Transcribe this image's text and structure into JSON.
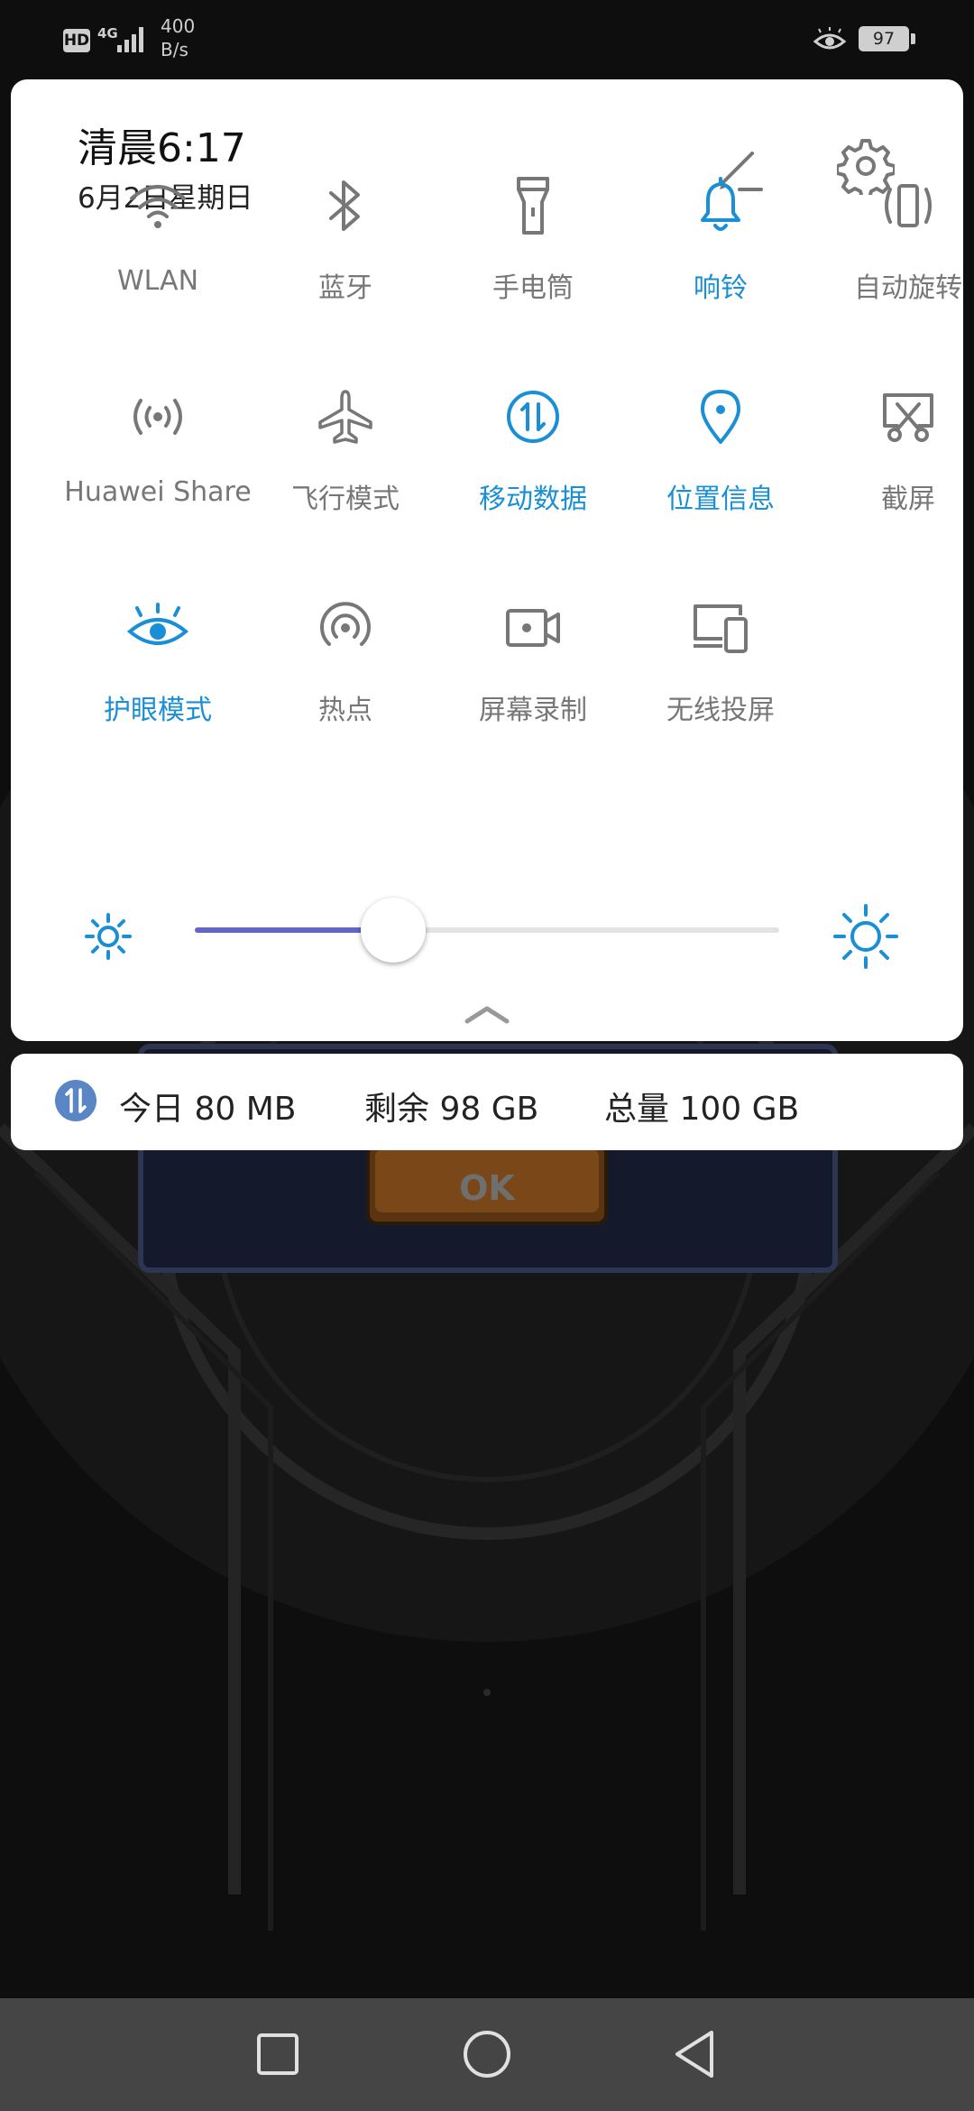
{
  "status_bar": {
    "hd": "HD",
    "network": "4G",
    "speed_value": "400",
    "speed_unit": "B/s",
    "battery": "97"
  },
  "header": {
    "time": "清晨6:17",
    "date": "6月2日星期日"
  },
  "colors": {
    "active": "#1a8fd6",
    "inactive": "#777777",
    "slider_fill": "#6366c8",
    "panel_bg": "#ffffff"
  },
  "tiles": [
    {
      "label": "WLAN",
      "icon": "wifi-icon",
      "active": false
    },
    {
      "label": "蓝牙",
      "icon": "bluetooth-icon",
      "active": false
    },
    {
      "label": "手电筒",
      "icon": "flashlight-icon",
      "active": false
    },
    {
      "label": "响铃",
      "icon": "bell-icon",
      "active": true
    },
    {
      "label": "自动旋转",
      "icon": "rotate-icon",
      "active": false
    },
    {
      "label": "Huawei Share",
      "icon": "huawei-share-icon",
      "active": false
    },
    {
      "label": "飞行模式",
      "icon": "airplane-icon",
      "active": false
    },
    {
      "label": "移动数据",
      "icon": "mobile-data-icon",
      "active": true
    },
    {
      "label": "位置信息",
      "icon": "location-icon",
      "active": true
    },
    {
      "label": "截屏",
      "icon": "screenshot-icon",
      "active": false
    },
    {
      "label": "护眼模式",
      "icon": "eye-comfort-icon",
      "active": true
    },
    {
      "label": "热点",
      "icon": "hotspot-icon",
      "active": false
    },
    {
      "label": "屏幕录制",
      "icon": "screen-record-icon",
      "active": false
    },
    {
      "label": "无线投屏",
      "icon": "wireless-projection-icon",
      "active": false
    }
  ],
  "brightness": {
    "level": 0.34
  },
  "data_usage": {
    "today": "今日 80 MB",
    "remaining": "剩余 98 GB",
    "total": "总量 100 GB"
  }
}
